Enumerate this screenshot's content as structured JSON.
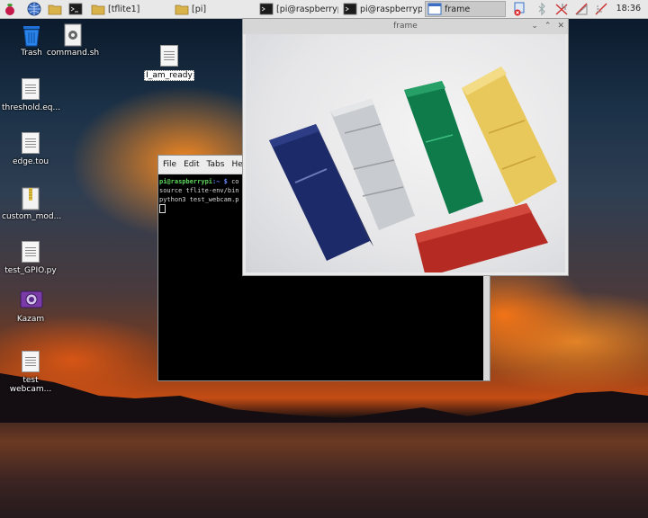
{
  "taskbar": {
    "tasks": [
      {
        "label": "[tflite1]"
      },
      {
        "label": "[pi]"
      },
      {
        "label": "[pi@raspberrypi: ..."
      },
      {
        "label": "pi@raspberrypi: ~"
      },
      {
        "label": "frame"
      }
    ],
    "clock": "18:36"
  },
  "desktop": {
    "icons": [
      {
        "label": "Trash"
      },
      {
        "label": "command.sh"
      },
      {
        "label": "I_am_ready"
      },
      {
        "label": "threshold.eq..."
      },
      {
        "label": "edge.tou"
      },
      {
        "label": "custom_mod..."
      },
      {
        "label": "test_GPIO.py"
      },
      {
        "label": "Kazam"
      },
      {
        "label": "test webcam..."
      }
    ]
  },
  "terminal": {
    "menu": [
      "File",
      "Edit",
      "Tabs",
      "Hel"
    ],
    "prompt_user": "pi@raspberrypi",
    "prompt_path": ":~ $",
    "line1_cmd": " co",
    "line2": "source tflite-env/bin",
    "line3": "python3 test_webcam.p"
  },
  "frame_window": {
    "title": "frame",
    "buttons": [
      "⌄",
      "⌃",
      "✕"
    ],
    "colors": {
      "blue_block": "#1d2a6a",
      "silver_block": "#c8cbcf",
      "green_block": "#0f7a4a",
      "yellow_block": "#e8c85a",
      "red_block": "#b52a22"
    }
  }
}
